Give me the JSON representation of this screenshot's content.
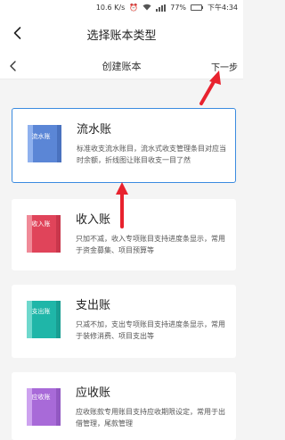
{
  "status_bar": {
    "network_speed": "10.6 K/s",
    "battery": "77%",
    "time": "下午4:34",
    "battery_level": 0.77
  },
  "header": {
    "title": "选择账本类型",
    "back_icon": "chevron-left-icon"
  },
  "sub_header": {
    "title": "创建账本",
    "next_label": "下一步",
    "back_icon": "chevron-left-icon"
  },
  "ledgers": [
    {
      "name": "流水账",
      "icon_label": "流水账",
      "icon_color": "#5b86d6",
      "icon_accent": "#8fb1ee",
      "description": "标准收支流水账目，流水式收支管理条目对应当时余额，折线图让账目收支一目了然",
      "selected": true
    },
    {
      "name": "收入账",
      "icon_label": "收入账",
      "icon_color": "#e0445a",
      "icon_accent": "#f08a98",
      "description": "只加不减，收入专项账目支持进度条显示，常用于资金募集、项目预算等",
      "selected": false
    },
    {
      "name": "支出账",
      "icon_label": "支出账",
      "icon_color": "#1fb6a8",
      "icon_accent": "#6fd8cd",
      "description": "只减不加，支出专项账目支持进度条显示，常用于装修消费、项目支出等",
      "selected": false
    },
    {
      "name": "应收账",
      "icon_label": "应收账",
      "icon_color": "#a86ad8",
      "icon_accent": "#cda2ef",
      "description": "应收账款专用账目支持应收期限设定，常用于出借管理，尾款管理",
      "selected": false
    }
  ],
  "annotation_color": "#e8222e"
}
